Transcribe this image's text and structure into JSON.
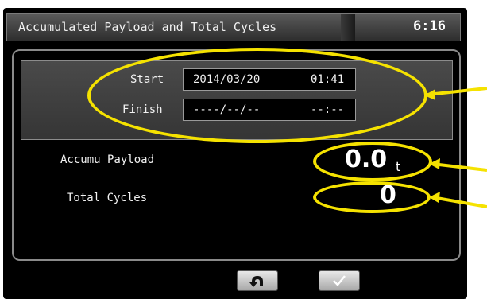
{
  "header": {
    "title": "Accumulated Payload and Total Cycles",
    "clock": "6:16"
  },
  "time_panel": {
    "start_label": "Start",
    "start_date": "2014/03/20",
    "start_time": "01:41",
    "finish_label": "Finish",
    "finish_date": "----/--/--",
    "finish_time": "--:--"
  },
  "stats": {
    "payload_label": "Accumu Payload",
    "payload_value": "0.0",
    "payload_unit": "t",
    "cycles_label": "Total Cycles",
    "cycles_value": "0"
  },
  "footer": {
    "back_icon": "return-arrow-icon",
    "confirm_icon": "checkmark-icon"
  },
  "annotations": {
    "highlight_color": "#f5e200"
  }
}
